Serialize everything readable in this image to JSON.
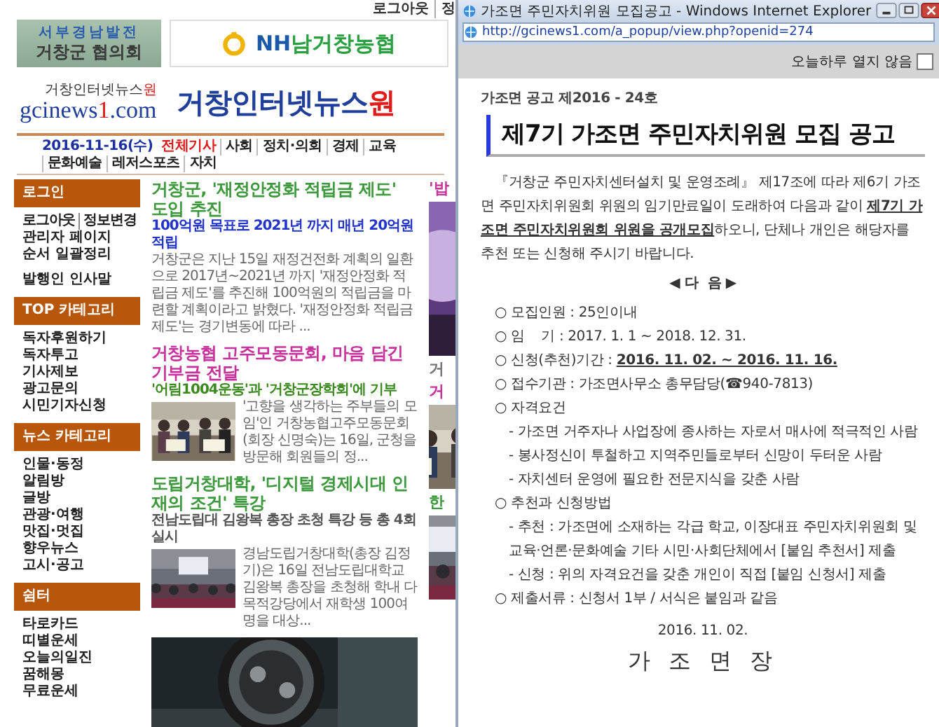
{
  "site": {
    "top_links": [
      "로그아웃",
      "정"
    ],
    "banners": [
      {
        "kind": "regional",
        "lines": [
          "서부경남발전",
          "거창군 협의회"
        ]
      },
      {
        "kind": "bank",
        "parts": [
          {
            "text": "NH",
            "accent": true
          },
          {
            "text": "남거창농협",
            "accent": false
          }
        ]
      }
    ],
    "logo": {
      "tagline_parts": [
        {
          "text": "거창인터넷뉴스",
          "accent": false
        },
        {
          "text": "원",
          "accent": true
        }
      ],
      "domain_parts": [
        {
          "text": "gcinews",
          "accent": false
        },
        {
          "text": "1",
          "accent": true
        },
        {
          "text": ".com",
          "accent": false
        }
      ]
    },
    "title_parts": [
      {
        "text": "거창인터넷뉴스",
        "accent": false
      },
      {
        "text": "원",
        "accent": true
      }
    ],
    "nav": {
      "date": "2016-11-16(수)",
      "items": [
        {
          "label": "전체기사",
          "selected": true
        },
        {
          "label": "사회",
          "selected": false
        },
        {
          "label": "정치·의회",
          "selected": false
        },
        {
          "label": "경제",
          "selected": false
        },
        {
          "label": "교육",
          "selected": false
        },
        {
          "label": "문화예술",
          "selected": false
        },
        {
          "label": "레저스포츠",
          "selected": false
        },
        {
          "label": "자치",
          "selected": false
        }
      ]
    },
    "sidebar": [
      {
        "title": "로그인",
        "items": [
          {
            "kind": "pair",
            "labels": [
              "로그아웃",
              "정보변경"
            ]
          },
          {
            "kind": "link",
            "label": "관리자 페이지"
          },
          {
            "kind": "link",
            "label": "순서 일괄정리"
          },
          {
            "kind": "featured",
            "label": "발행인 인사말"
          }
        ]
      },
      {
        "title": "TOP 카테고리",
        "items": [
          {
            "kind": "link",
            "label": "독자후원하기"
          },
          {
            "kind": "link",
            "label": "독자투고"
          },
          {
            "kind": "link",
            "label": "기사제보"
          },
          {
            "kind": "link",
            "label": "광고문의"
          },
          {
            "kind": "link",
            "label": "시민기자신청"
          }
        ]
      },
      {
        "title": "뉴스 카테고리",
        "items": [
          {
            "kind": "link",
            "label": "인물·동정"
          },
          {
            "kind": "link",
            "label": "알림방"
          },
          {
            "kind": "link",
            "label": "글방"
          },
          {
            "kind": "link",
            "label": "관광·여행"
          },
          {
            "kind": "link",
            "label": "맛집·멋집"
          },
          {
            "kind": "link",
            "label": "향우뉴스"
          },
          {
            "kind": "link",
            "label": "고시·공고"
          }
        ]
      },
      {
        "title": "쉼터",
        "items": [
          {
            "kind": "link",
            "label": "타로카드"
          },
          {
            "kind": "link",
            "label": "띠별운세"
          },
          {
            "kind": "link",
            "label": "오늘의일진"
          },
          {
            "kind": "link",
            "label": "꿈해몽"
          },
          {
            "kind": "link",
            "label": "무료운세"
          }
        ]
      }
    ],
    "articles": [
      {
        "title": "거창군, '재정안정화 적립금 제도' 도입 추진",
        "color": "#3c9a3c",
        "subtitle": {
          "text": "100억원 목표로 2021년 까지 매년 20억원 적립",
          "color": "#2233cc"
        },
        "summary": "거창군은 지난 15일 재정건전화 계획의 일환으로 2017년~2021년 까지 '재정안정화 적립금 제도'를 추진해 100억원의 적립금을 마련할 계획이라고 밝혔다. '재정안정화 적립금 제도'는 경기변동에 따라 ..."
      },
      {
        "title": "거창농협 고주모동문회, 마음 담긴 기부금 전달",
        "color": "#c8329c",
        "subtitle": {
          "text": "'어림1004운동'과 '거창군장학회'에 기부",
          "color": "#3a8a1e"
        },
        "media": {
          "kind": "picture"
        },
        "summary": "'고향을 생각하는 주부들의 모임'인 거창농협고주모동문회(회장 신명숙)는 16일, 군청을 방문해 회원들의 정..."
      },
      {
        "title": "도립거창대학, '디지털 경제시대 인재의 조건' 특강",
        "color": "#3c9a3c",
        "subtitle": {
          "text": "전남도립대 김왕복 총장 초청 특강 등 총 4회 실시",
          "color": "#555555"
        },
        "media": {
          "kind": "picture"
        },
        "summary": "경남도립거창대학(총장 김정기)은 16일 전남도립대학교 김왕복 총장을 초청해 학내 다목적강당에서 재학생 100여명을 대상..."
      }
    ],
    "ad": {
      "kind": "picture"
    },
    "side_column": [
      {
        "kind": "text",
        "text": "'밥",
        "color": "#c8329c"
      },
      {
        "kind": "picture"
      },
      {
        "kind": "text",
        "text": "거",
        "color": "#777777"
      },
      {
        "kind": "text",
        "text": "거",
        "color": "#c8329c"
      },
      {
        "kind": "picture"
      },
      {
        "kind": "text",
        "text": "한",
        "color": "#3c9a3c"
      },
      {
        "kind": "picture"
      }
    ]
  },
  "popup": {
    "title": "가조면 주민자치위원 모집공고 - Windows Internet Explorer",
    "url": "http://gcinews1.com/a_popup/view.php?openid=274",
    "dismiss": {
      "label": "오늘하루 열지 않음",
      "checked": false
    },
    "notice": {
      "number": "가조면 공고 제2016 - 24호",
      "heading": "제7기 가조면 주민자치위원 모집 공고",
      "intro": "『거창군 주민자치센터설치 및 운영조례』 제17조에 따라 제6기 가조면 주민자치위원회 위원의 임기만료일이 도래하여 다음과 같이 **제7기 가조면 주민자치위원회 위원을 공개모집**하오니, 단체나 개인은 해당자를 추천 또는 신청해 주시기 바랍니다.",
      "divider": "◀ 다  음 ▶",
      "items": [
        {
          "kind": "item",
          "marker": "○",
          "text": "모집인원 : 25인이내"
        },
        {
          "kind": "item",
          "marker": "○",
          "text": "임    기 : 2017. 1. 1 ~ 2018. 12. 31."
        },
        {
          "kind": "item",
          "marker": "○",
          "text": "신청(추천)기간 : ",
          "underlined": "2016. 11. 02. ~ 2016. 11. 16."
        },
        {
          "kind": "item",
          "marker": "○",
          "text": "접수기관 : 가조면사무소 총무담당(☎940-7813)"
        },
        {
          "kind": "item",
          "marker": "○",
          "text": "자격요건"
        },
        {
          "kind": "sub",
          "marker": "-",
          "text": "가조면 거주자나 사업장에 종사하는 자로서 매사에 적극적인 사람"
        },
        {
          "kind": "sub",
          "marker": "-",
          "text": "봉사정신이 투철하고 지역주민들로부터 신망이 두터운 사람"
        },
        {
          "kind": "sub",
          "marker": "-",
          "text": "자치센터 운영에 필요한 전문지식을 갖춘 사람"
        },
        {
          "kind": "item",
          "marker": "○",
          "text": "추천과 신청방법"
        },
        {
          "kind": "sub",
          "marker": "-",
          "text": "추천 : 가조면에 소재하는 각급 학교, 이장대표 주민자치위원회 및 교육·언론·문화예술 기타 시민·사회단체에서 [붙임 추천서] 제출"
        },
        {
          "kind": "sub",
          "marker": "-",
          "text": "신청 : 위의 자격요건을 갖춘 개인이 직접 [붙임 신청서] 제출"
        },
        {
          "kind": "item",
          "marker": "○",
          "text": "제출서류 : 신청서 1부 / 서식은 붙임과 같음"
        }
      ],
      "date": "2016. 11. 02.",
      "signer": "가 조 면 장"
    }
  }
}
